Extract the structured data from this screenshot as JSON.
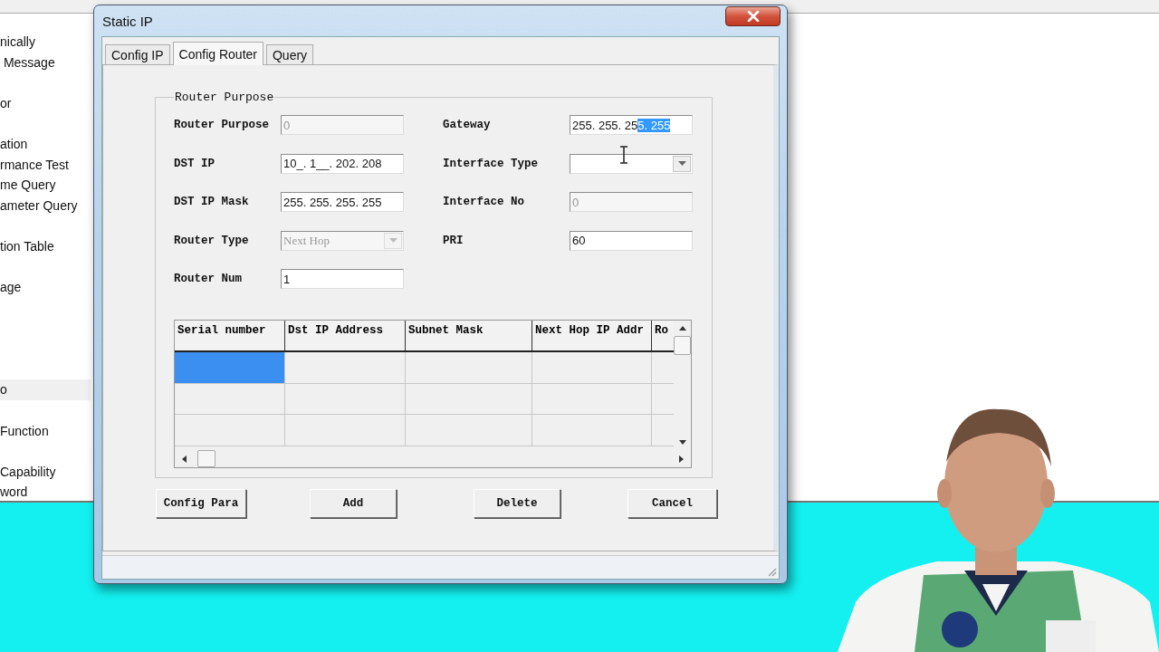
{
  "background_list": {
    "items": [
      {
        "label": "nically",
        "selected": false
      },
      {
        "label": " Message",
        "selected": false
      },
      {
        "label": "or",
        "selected": false
      },
      {
        "label": "ation",
        "selected": false
      },
      {
        "label": "rmance Test",
        "selected": false
      },
      {
        "label": "me Query",
        "selected": false
      },
      {
        "label": "ameter Query",
        "selected": false
      },
      {
        "label": "tion Table",
        "selected": false
      },
      {
        "label": "age",
        "selected": false
      },
      {
        "label": "o",
        "selected": true
      },
      {
        "label": "Function",
        "selected": false
      },
      {
        "label": "Capability",
        "selected": false
      },
      {
        "label": "word",
        "selected": false
      }
    ]
  },
  "window": {
    "title": "Static IP"
  },
  "tabs": [
    {
      "label": "Config IP",
      "selected": false
    },
    {
      "label": "Config Router",
      "selected": true
    },
    {
      "label": "Query",
      "selected": false
    }
  ],
  "group": {
    "title": "Router Purpose",
    "left_fields": [
      {
        "label": "Router Purpose",
        "kind": "text",
        "value": "0",
        "disabled": true
      },
      {
        "label": "DST IP",
        "kind": "text",
        "value": "10_. 1__. 202. 208",
        "disabled": false
      },
      {
        "label": "DST IP Mask",
        "kind": "text",
        "value": "255. 255. 255. 255",
        "disabled": false
      },
      {
        "label": "Router Type",
        "kind": "dropdown",
        "value": "Next Hop",
        "disabled": true
      },
      {
        "label": "Router Num",
        "kind": "text",
        "value": "1",
        "disabled": false
      }
    ],
    "right_fields": [
      {
        "label": "Gateway",
        "kind": "text",
        "value": "255. 255. 25",
        "highlighted": "5. 255",
        "disabled": false
      },
      {
        "label": "Interface Type",
        "kind": "dropdown",
        "disabled": false
      },
      {
        "label": "Interface No",
        "kind": "text",
        "value": "0",
        "disabled": true
      },
      {
        "label": "PRI",
        "kind": "text",
        "value": "60",
        "disabled": false
      }
    ],
    "table": {
      "columns": [
        "Serial number",
        "Dst IP Address",
        "Subnet Mask",
        "Next Hop IP Addr",
        "Ro"
      ],
      "rows": [
        {
          "selected": true
        },
        {
          "selected": false
        },
        {
          "selected": false
        }
      ]
    }
  },
  "buttons": [
    "Config Para",
    "Add",
    "Delete",
    "Cancel"
  ]
}
